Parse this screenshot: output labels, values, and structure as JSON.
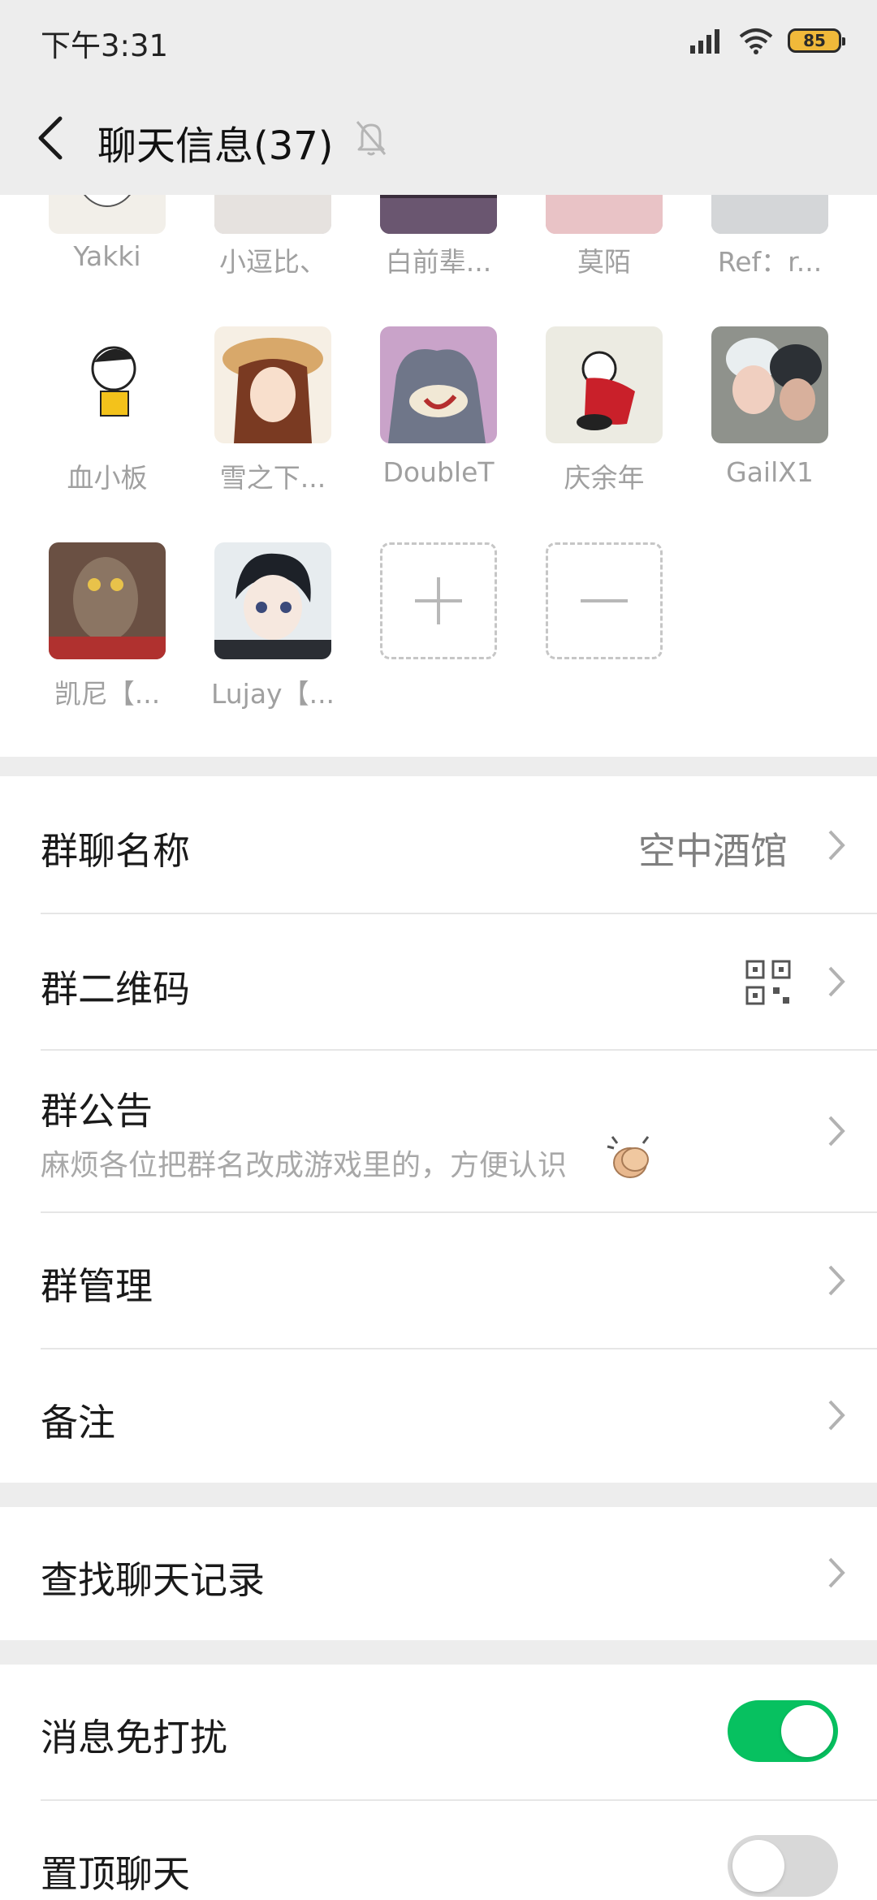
{
  "status_bar": {
    "time": "下午3:31",
    "battery": "85"
  },
  "header": {
    "title": "聊天信息(37)"
  },
  "members": [
    {
      "name": "Yakki"
    },
    {
      "name": "小逗比、"
    },
    {
      "name": "白前辈..."
    },
    {
      "name": "莫陌"
    },
    {
      "name": "Ref：r..."
    },
    {
      "name": "血小板"
    },
    {
      "name": "雪之下..."
    },
    {
      "name": "DoubleT"
    },
    {
      "name": "庆余年"
    },
    {
      "name": "GailX1"
    },
    {
      "name": "凯尼【..."
    },
    {
      "name": "Lujay【..."
    }
  ],
  "settings": {
    "group_name": {
      "label": "群聊名称",
      "value": "空中酒馆"
    },
    "qr_code": {
      "label": "群二维码"
    },
    "announcement": {
      "label": "群公告",
      "text": "麻烦各位把群名改成游戏里的，方便认识"
    },
    "manage": {
      "label": "群管理"
    },
    "remark": {
      "label": "备注"
    },
    "search_history": {
      "label": "查找聊天记录"
    },
    "mute": {
      "label": "消息免打扰",
      "on": true
    },
    "pin": {
      "label": "置顶聊天",
      "on": false
    }
  },
  "colors": {
    "toggle_on": "#07c160",
    "toggle_off": "#d8d8d8",
    "background": "#ededed"
  }
}
